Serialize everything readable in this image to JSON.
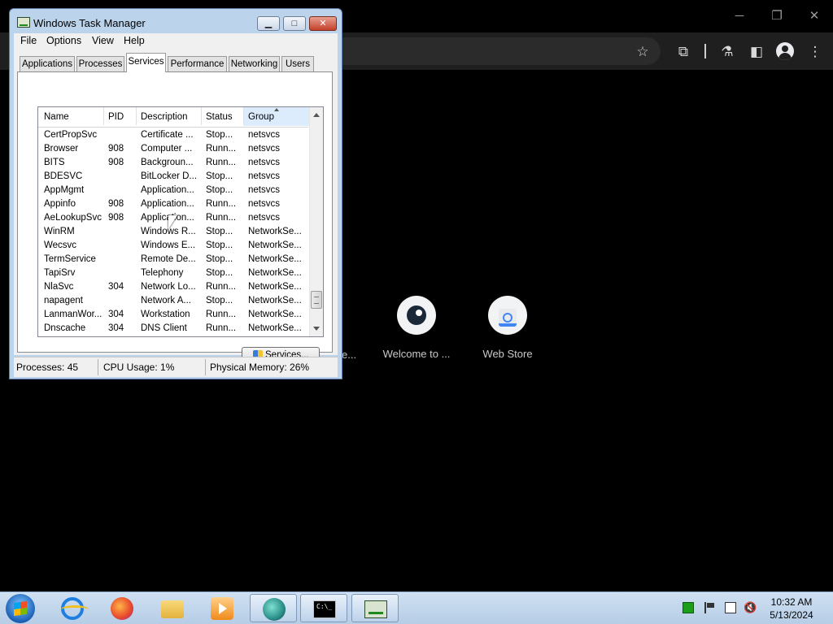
{
  "browser": {
    "window_controls": {
      "minimize": "─",
      "restore": "❐",
      "close": "✕"
    },
    "shortcuts": [
      {
        "label": "e...",
        "icon": "web-icon"
      },
      {
        "label": "Welcome to ...",
        "icon": "steam-icon"
      },
      {
        "label": "Web Store",
        "icon": "webstore-icon"
      }
    ]
  },
  "task_manager": {
    "title": "Windows Task Manager",
    "caption_buttons": {
      "minimize": "▁",
      "maximize": "□",
      "close": "✕"
    },
    "menu": [
      "File",
      "Options",
      "View",
      "Help"
    ],
    "tabs": [
      "Applications",
      "Processes",
      "Services",
      "Performance",
      "Networking",
      "Users"
    ],
    "active_tab": "Services",
    "columns": [
      "Name",
      "PID",
      "Description",
      "Status",
      "Group"
    ],
    "sorted_column": "Group",
    "rows": [
      {
        "name": "CertPropSvc",
        "pid": "",
        "description": "Certificate ...",
        "status": "Stop...",
        "group": "netsvcs"
      },
      {
        "name": "Browser",
        "pid": "908",
        "description": "Computer ...",
        "status": "Runn...",
        "group": "netsvcs"
      },
      {
        "name": "BITS",
        "pid": "908",
        "description": "Backgroun...",
        "status": "Runn...",
        "group": "netsvcs"
      },
      {
        "name": "BDESVC",
        "pid": "",
        "description": "BitLocker D...",
        "status": "Stop...",
        "group": "netsvcs"
      },
      {
        "name": "AppMgmt",
        "pid": "",
        "description": "Application...",
        "status": "Stop...",
        "group": "netsvcs"
      },
      {
        "name": "Appinfo",
        "pid": "908",
        "description": "Application...",
        "status": "Runn...",
        "group": "netsvcs"
      },
      {
        "name": "AeLookupSvc",
        "pid": "908",
        "description": "Application...",
        "status": "Runn...",
        "group": "netsvcs"
      },
      {
        "name": "WinRM",
        "pid": "",
        "description": "Windows R...",
        "status": "Stop...",
        "group": "NetworkSe..."
      },
      {
        "name": "Wecsvc",
        "pid": "",
        "description": "Windows E...",
        "status": "Stop...",
        "group": "NetworkSe..."
      },
      {
        "name": "TermService",
        "pid": "",
        "description": "Remote De...",
        "status": "Stop...",
        "group": "NetworkSe..."
      },
      {
        "name": "TapiSrv",
        "pid": "",
        "description": "Telephony",
        "status": "Stop...",
        "group": "NetworkSe..."
      },
      {
        "name": "NlaSvc",
        "pid": "304",
        "description": "Network Lo...",
        "status": "Runn...",
        "group": "NetworkSe..."
      },
      {
        "name": "napagent",
        "pid": "",
        "description": "Network A...",
        "status": "Stop...",
        "group": "NetworkSe..."
      },
      {
        "name": "LanmanWor...",
        "pid": "304",
        "description": "Workstation",
        "status": "Runn...",
        "group": "NetworkSe..."
      },
      {
        "name": "Dnscache",
        "pid": "304",
        "description": "DNS Client",
        "status": "Runn...",
        "group": "NetworkSe..."
      }
    ],
    "services_button": "Services...",
    "status_bar": {
      "processes": "Processes: 45",
      "cpu": "CPU Usage: 1%",
      "memory": "Physical Memory: 26%"
    }
  },
  "taskbar": {
    "apps": [
      "internet-explorer",
      "firefox",
      "file-explorer",
      "media-player",
      "microsoft-edge",
      "command-prompt",
      "task-manager"
    ],
    "active_apps": [
      "microsoft-edge",
      "command-prompt",
      "task-manager"
    ],
    "clock": {
      "time": "10:32 AM",
      "date": "5/13/2024"
    }
  }
}
